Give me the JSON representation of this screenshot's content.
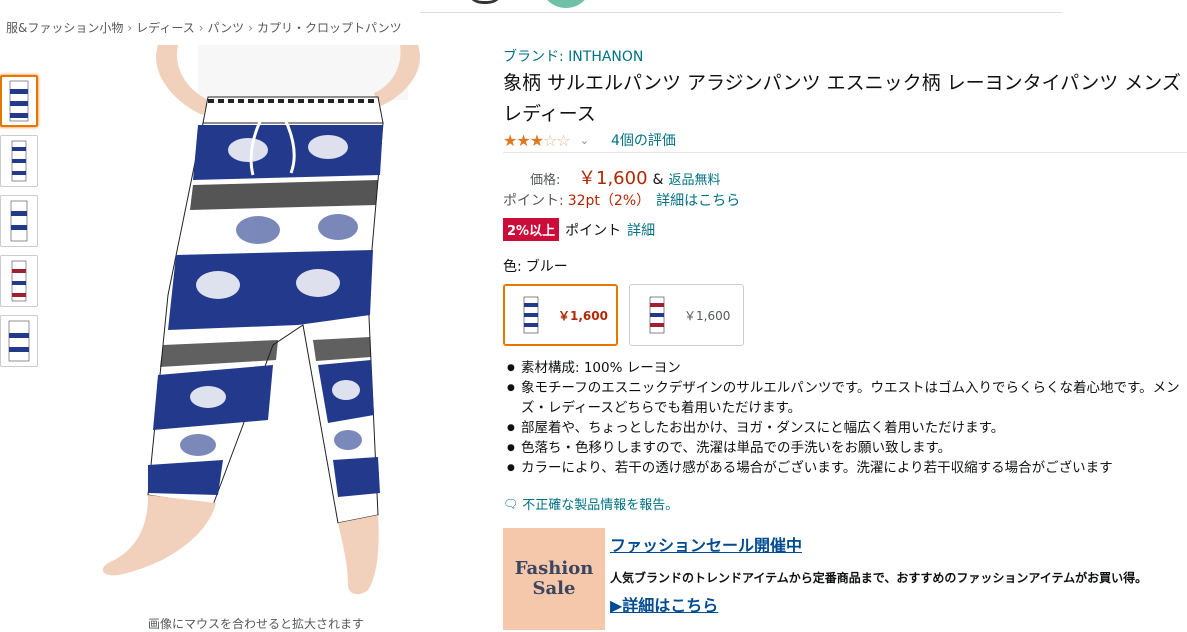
{
  "breadcrumb": {
    "items": [
      "服&ファッション小物",
      "レディース",
      "パンツ",
      "カプリ・クロップトパンツ"
    ],
    "separator": "›"
  },
  "gallery": {
    "thumbnail_count": 5,
    "zoom_hint": "画像にマウスを合わせると拡大されます"
  },
  "product": {
    "brand": "ブランド: INTHANON",
    "title": "象柄 サルエルパンツ アラジンパンツ エスニック柄 レーヨンタイパンツ メンズ レディース",
    "rating_stars": 3,
    "rating_max": 5,
    "reviews": "4個の評価"
  },
  "price": {
    "label": "価格:",
    "value": "￥1,600",
    "amp": "&",
    "returns": "返品無料"
  },
  "points": {
    "label": "ポイント:",
    "value": "32pt（2%）",
    "link": "詳細はこちら"
  },
  "percent_promo": {
    "badge": "2%以上",
    "text": "ポイント",
    "link": "詳細"
  },
  "color": {
    "label": "色:",
    "value": "ブルー"
  },
  "swatches": [
    {
      "price": "￥1,600",
      "selected": true
    },
    {
      "price": "￥1,600",
      "selected": false
    }
  ],
  "bullets": [
    "素材構成: 100% レーヨン",
    "象モチーフのエスニックデザインのサルエルパンツです。ウエストはゴム入りでらくらくな着心地です。メンズ・レディースどちらでも着用いただけます。",
    "部屋着や、ちょっとしたお出かけ、ヨガ・ダンスにと幅広く着用いただけます。",
    "色落ち・色移りしますので、洗濯は単品での手洗いをお願い致します。",
    "カラーにより、若干の透け感がある場合がございます。洗濯により若干収縮する場合がございます"
  ],
  "report": {
    "icon": "speech-bubble-icon",
    "text": "不正確な製品情報を報告。"
  },
  "sale": {
    "image_word1": "Fashion",
    "image_word2": "Sale",
    "title": "ファッションセール開催中",
    "description": "人気ブランドのトレンドアイテムから定番商品まで、おすすめのファッションアイテムがお買い得。",
    "link": "▶詳細はこちら"
  },
  "colors": {
    "link": "#007185",
    "price": "#b12704",
    "star": "#de7921",
    "badge": "#cc0c39",
    "selected_border": "#e77600",
    "pants_blue": "#233a8c"
  }
}
